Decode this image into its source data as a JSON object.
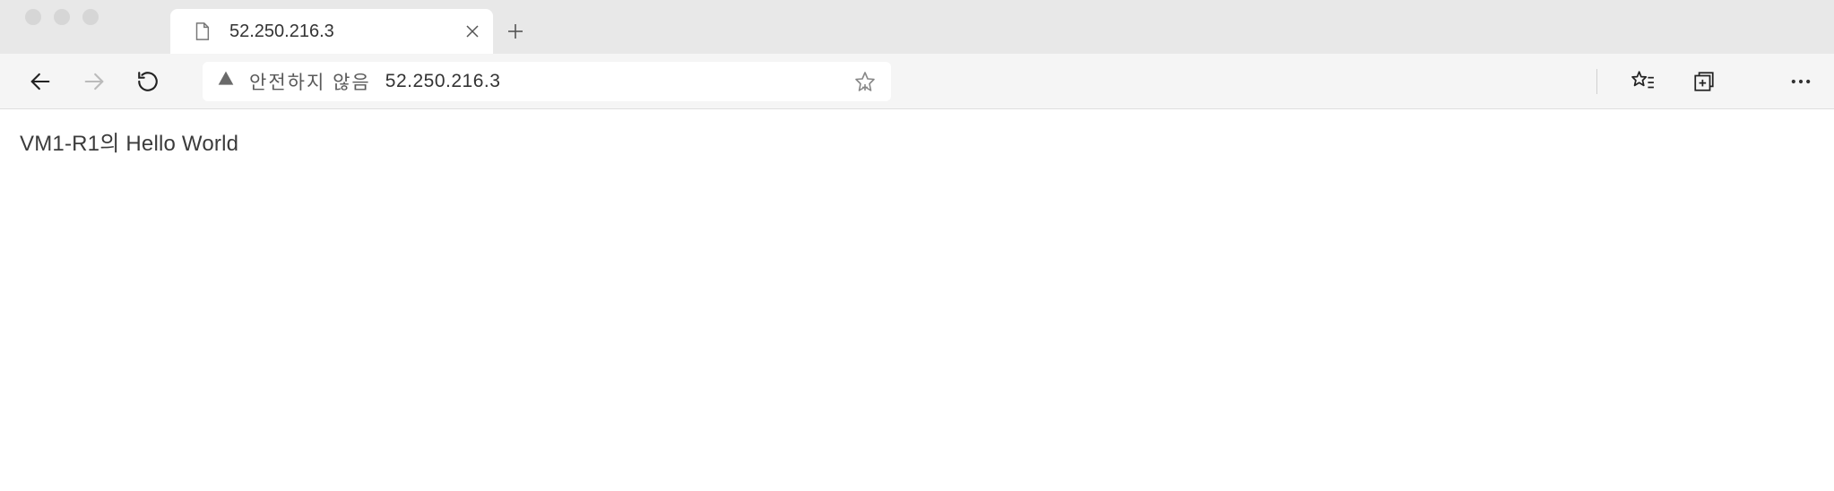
{
  "tab": {
    "title": "52.250.216.3"
  },
  "address": {
    "security_label": "안전하지 않음",
    "url": "52.250.216.3"
  },
  "page": {
    "body_text": "VM1-R1의 Hello World"
  }
}
